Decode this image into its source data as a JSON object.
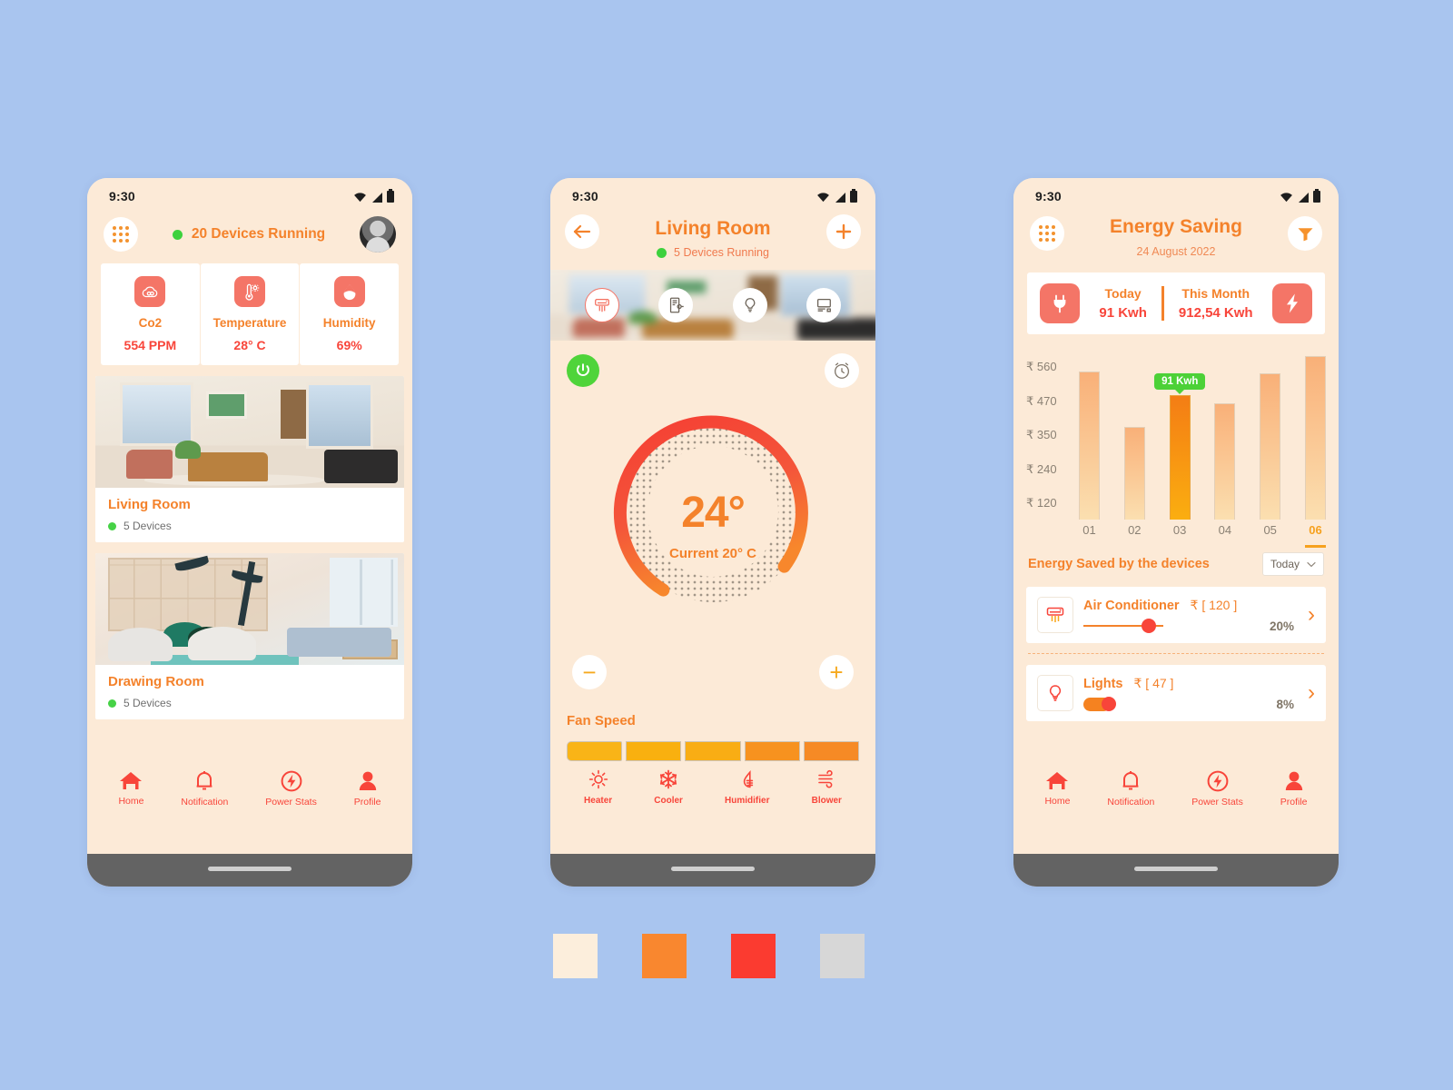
{
  "palette": {
    "cream": "#FCEEDC",
    "orange": "#F9872F",
    "red": "#FB3B30",
    "gray": "#D7D7D7",
    "background": "#A9C5EF",
    "coral": "#F47567",
    "green": "#4CD137"
  },
  "swatches": [
    {
      "name": "cream",
      "hex": "#FCEEDC"
    },
    {
      "name": "orange",
      "hex": "#F9872F"
    },
    {
      "name": "red",
      "hex": "#FB3B30"
    },
    {
      "name": "gray",
      "hex": "#D7D7D7"
    }
  ],
  "screen1": {
    "status": {
      "time": "9:30"
    },
    "header": {
      "devices_running": "20 Devices Running"
    },
    "sensors": [
      {
        "icon": "co2-cloud-icon",
        "label": "Co2",
        "value": "554 PPM"
      },
      {
        "icon": "thermometer-icon",
        "label": "Temperature",
        "value": "28° C"
      },
      {
        "icon": "humidity-drop-icon",
        "label": "Humidity",
        "value": "69%"
      }
    ],
    "rooms": [
      {
        "title": "Living Room",
        "devices": "5 Devices"
      },
      {
        "title": "Drawing Room",
        "devices": "5 Devices"
      }
    ],
    "nav": [
      {
        "icon": "home-icon",
        "label": "Home"
      },
      {
        "icon": "bell-icon",
        "label": "Notification"
      },
      {
        "icon": "power-bolt-icon",
        "label": "Power Stats"
      },
      {
        "icon": "profile-icon",
        "label": "Profile"
      }
    ]
  },
  "screen2": {
    "status": {
      "time": "9:30"
    },
    "header": {
      "back": "back-arrow-icon",
      "title": "Living Room",
      "subtitle": "5 Devices Running",
      "add": "plus-icon"
    },
    "devices": [
      {
        "icon": "air-conditioner-icon",
        "active": true
      },
      {
        "icon": "door-lock-icon",
        "active": false
      },
      {
        "icon": "light-bulb-icon",
        "active": false
      },
      {
        "icon": "tv-monitor-icon",
        "active": false
      }
    ],
    "power_button": "power-icon",
    "timer_button": "alarm-clock-icon",
    "dial": {
      "target": "24°",
      "current": "Current 20° C"
    },
    "stepper": {
      "minus": "−",
      "plus": "+"
    },
    "fan": {
      "label": "Fan Speed",
      "segments": 5,
      "active": 5
    },
    "modes": [
      {
        "icon": "sun-icon",
        "label": "Heater"
      },
      {
        "icon": "snowflake-icon",
        "label": "Cooler"
      },
      {
        "icon": "humidifier-icon",
        "label": "Humidifier"
      },
      {
        "icon": "blower-icon",
        "label": "Blower"
      }
    ]
  },
  "screen3": {
    "status": {
      "time": "9:30"
    },
    "header": {
      "menu": "grid-menu-icon",
      "title": "Energy Saving",
      "date": "24 August 2022",
      "filter": "filter-icon"
    },
    "kpi": {
      "left_icon": "plug-icon",
      "right_icon": "bolt-icon",
      "today_label": "Today",
      "today_value": "91 Kwh",
      "month_label": "This Month",
      "month_value": "912,54 Kwh"
    },
    "saved": {
      "title": "Energy Saved by the devices",
      "dropdown_value": "Today",
      "dropdown_icon": "chevron-down-icon"
    },
    "devices": [
      {
        "icon": "air-conditioner-icon",
        "name": "Air Conditioner",
        "cost": "₹ [ 120 ]",
        "percent": "20%",
        "slider_fill": 70,
        "style": "line",
        "chevron": "chevron-right-icon"
      },
      {
        "icon": "light-bulb-icon",
        "name": "Lights",
        "cost": "₹ [ 47 ]",
        "percent": "8%",
        "slider_fill": 30,
        "style": "pill",
        "chevron": "chevron-right-icon"
      }
    ],
    "nav": [
      {
        "icon": "home-icon",
        "label": "Home"
      },
      {
        "icon": "bell-icon",
        "label": "Notification"
      },
      {
        "icon": "power-bolt-icon",
        "label": "Power Stats"
      },
      {
        "icon": "profile-icon",
        "label": "Profile"
      }
    ]
  },
  "chart_data": {
    "type": "bar",
    "title": "Energy Saving",
    "xlabel": "",
    "ylabel": "₹",
    "categories": [
      "01",
      "02",
      "03",
      "04",
      "05",
      "06"
    ],
    "values": [
      560,
      352,
      470,
      440,
      555,
      620
    ],
    "ytick_labels": [
      "₹ 560",
      "₹ 470",
      "₹ 350",
      "₹ 240",
      "₹ 120"
    ],
    "ytick_values": [
      560,
      470,
      350,
      240,
      120
    ],
    "ylim": [
      0,
      640
    ],
    "grid": false,
    "legend": "none",
    "highlight_index": 2,
    "highlight_annotation": "91 Kwh",
    "selected_category": "06"
  }
}
